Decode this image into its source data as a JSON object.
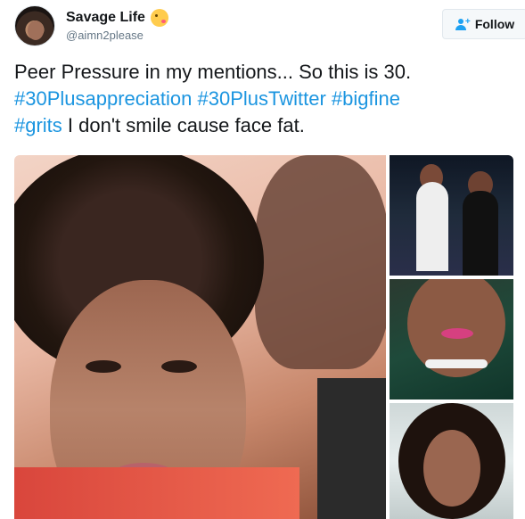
{
  "user": {
    "display_name": "Savage Life",
    "handle": "@aimn2please",
    "emoji_icon": "kissing-face-emoji"
  },
  "follow_button": {
    "label": "Follow",
    "icon": "add-user-icon"
  },
  "tweet": {
    "text_parts": {
      "p1": "Peer Pressure in my mentions... So this is 30. ",
      "h1": "#30Plusappreciation",
      "s1": " ",
      "h2": "#30PlusTwitter",
      "s2": " ",
      "h3": "#bigfine",
      "s3": " ",
      "h4": "#grits",
      "p2": " I don't smile cause face fat."
    }
  },
  "colors": {
    "hashtag": "#1b95e0",
    "text": "#14171a",
    "muted": "#657786"
  }
}
